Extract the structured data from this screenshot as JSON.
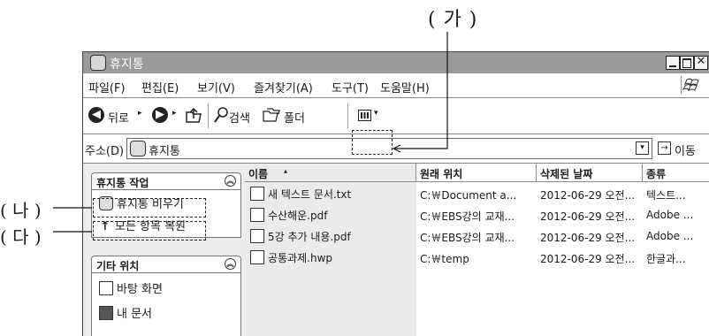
{
  "annotations": {
    "ga": "( 가 )",
    "na": "( 나 )",
    "da": "( 다 )"
  },
  "window": {
    "title": "휴지통"
  },
  "menu": [
    "파일(F)",
    "편집(E)",
    "보기(V)",
    "즐겨찾기(A)",
    "도구(T)",
    "도움말(H)"
  ],
  "toolbar": {
    "back": "뒤로",
    "search": "검색",
    "folder": "폴더"
  },
  "address": {
    "label": "주소(D)",
    "value": "휴지통",
    "go": "이동"
  },
  "left_panels": {
    "tasks_title": "휴지통 작업",
    "tasks": [
      "휴지통 비우기",
      "모든 항목 복원"
    ],
    "other_title": "기타 위치",
    "other": [
      "바탕 화면",
      "내 문서"
    ]
  },
  "columns": [
    "이름",
    "원래 위치",
    "삭제된 날짜",
    "종류"
  ],
  "files": [
    {
      "name": "새 텍스트 문서.txt",
      "location": "C:￦Document a...",
      "date": "2012-06-29 오전...",
      "type": "텍스트..."
    },
    {
      "name": "수산해운.pdf",
      "location": "C:￦EBS강의 교재...",
      "date": "2012-06-29 오전...",
      "type": "Adobe ..."
    },
    {
      "name": "5강 추가 내용.pdf",
      "location": "C:￦EBS강의 교재...",
      "date": "2012-06-29 오전...",
      "type": "Adobe ..."
    },
    {
      "name": "공통과제.hwp",
      "location": "C:￦temp",
      "date": "2012-06-29 오전...",
      "type": "한글과..."
    }
  ]
}
